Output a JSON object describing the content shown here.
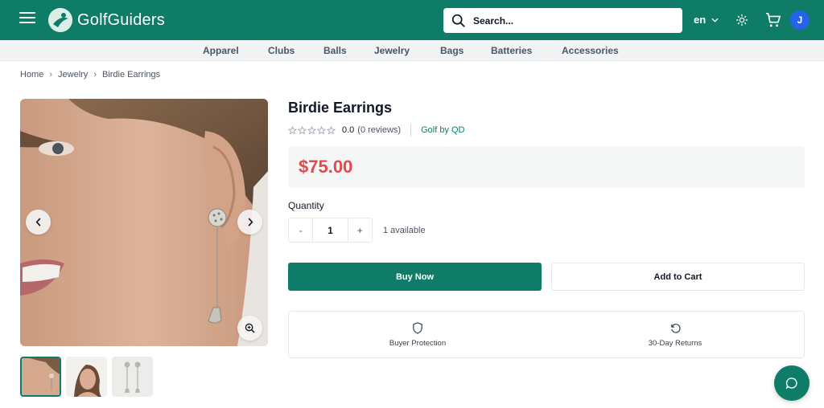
{
  "header": {
    "brand_name": "GolfGuiders",
    "search_placeholder": "Search...",
    "language": "en",
    "avatar_initial": "J",
    "colors": {
      "primary": "#0e7c66",
      "avatar": "#2563eb"
    }
  },
  "categories": [
    "Apparel",
    "Clubs",
    "Balls",
    "Jewelry",
    "Bags",
    "Batteries",
    "Accessories"
  ],
  "breadcrumb": [
    "Home",
    "Jewelry",
    "Birdie Earrings"
  ],
  "product": {
    "title": "Birdie Earrings",
    "rating": "0.0",
    "reviews": "(0 reviews)",
    "brand": "Golf by QD",
    "price": "$75.00",
    "quantity_label": "Quantity",
    "quantity": "1",
    "minus": "-",
    "plus": "+",
    "available": "1 available",
    "buy_now": "Buy Now",
    "add_to_cart": "Add to Cart",
    "price_color": "#e14b4b"
  },
  "features": [
    {
      "icon": "shield-icon",
      "label": "Buyer Protection"
    },
    {
      "icon": "return-arrow-icon",
      "label": "30-Day Returns"
    }
  ]
}
